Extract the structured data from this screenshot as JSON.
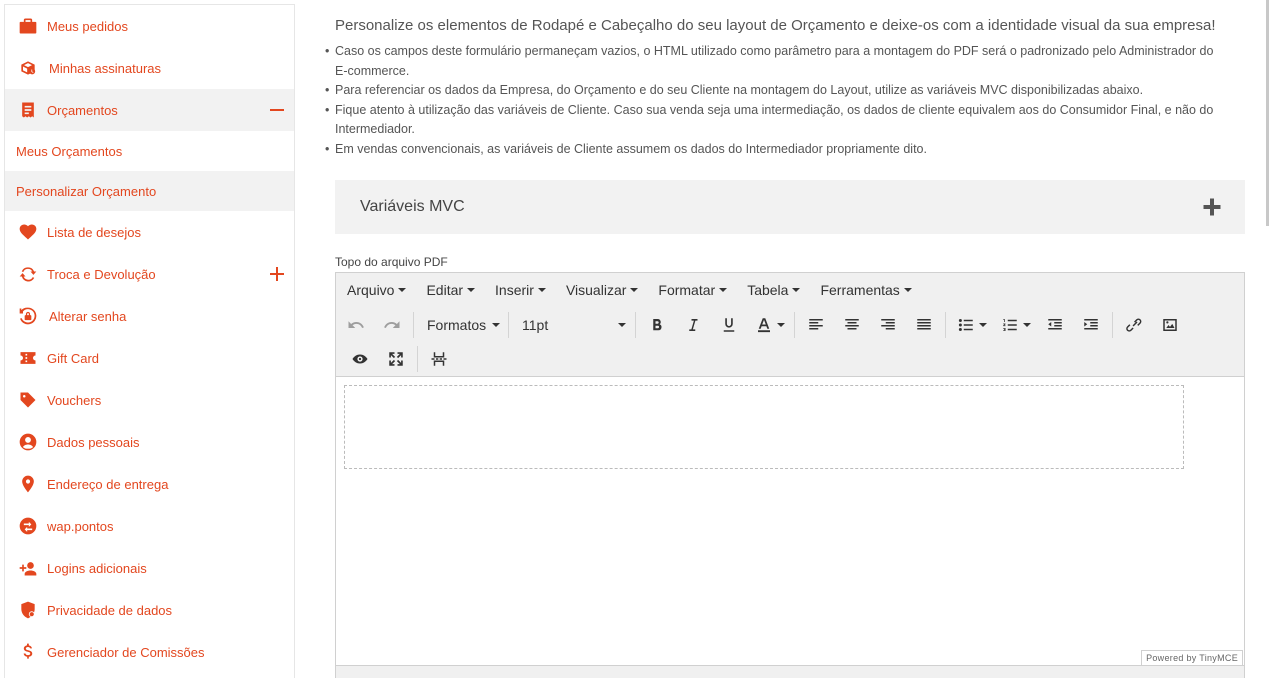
{
  "sidebar": {
    "items": [
      {
        "label": "Meus pedidos",
        "icon": "briefcase-icon"
      },
      {
        "label": "Minhas assinaturas",
        "icon": "subscription-box-icon"
      },
      {
        "label": "Orçamentos",
        "icon": "receipt-icon",
        "expanded": true,
        "children": [
          {
            "label": "Meus Orçamentos"
          },
          {
            "label": "Personalizar Orçamento",
            "active": true
          }
        ]
      },
      {
        "label": "Lista de desejos",
        "icon": "heart-icon"
      },
      {
        "label": "Troca e Devolução",
        "icon": "exchange-icon",
        "expandable": true
      },
      {
        "label": "Alterar senha",
        "icon": "lock-reset-icon"
      },
      {
        "label": "Gift Card",
        "icon": "ticket-icon"
      },
      {
        "label": "Vouchers",
        "icon": "tag-icon"
      },
      {
        "label": "Dados pessoais",
        "icon": "user-icon"
      },
      {
        "label": "Endereço de entrega",
        "icon": "map-pin-icon"
      },
      {
        "label": "wap.pontos",
        "icon": "points-swap-icon"
      },
      {
        "label": "Logins adicionais",
        "icon": "add-user-icon"
      },
      {
        "label": "Privacidade de dados",
        "icon": "shield-user-icon"
      },
      {
        "label": "Gerenciador de Comissões",
        "icon": "dollar-icon"
      }
    ]
  },
  "main": {
    "intro": "Personalize os elementos de Rodapé e Cabeçalho do seu layout de Orçamento e deixe-os com a identidade visual da sua empresa!",
    "bullets": [
      "Caso os campos deste formulário permaneçam vazios, o HTML utilizado como parâmetro para a montagem do PDF será o padronizado pelo Administrador do E-commerce.",
      "Para referenciar os dados da Empresa, do Orçamento e do seu Cliente na montagem do Layout, utilize as variáveis MVC disponibilizadas abaixo.",
      "Fique atento à utilização das variáveis de Cliente. Caso sua venda seja uma intermediação, os dados de cliente equivalem aos do Consumidor Final, e não do Intermediador.",
      "Em vendas convencionais, as variáveis de Cliente assumem os dados do Intermediador propriamente dito."
    ],
    "accordion_title": "Variáveis MVC",
    "field_label": "Topo do arquivo PDF"
  },
  "editor": {
    "menus": [
      "Arquivo",
      "Editar",
      "Inserir",
      "Visualizar",
      "Formatar",
      "Tabela",
      "Ferramentas"
    ],
    "formats_label": "Formatos",
    "font_size": "11pt",
    "powered_by": "Powered by TinyMCE"
  },
  "colors": {
    "accent": "#e3471f",
    "panel": "#f2f2f2"
  }
}
